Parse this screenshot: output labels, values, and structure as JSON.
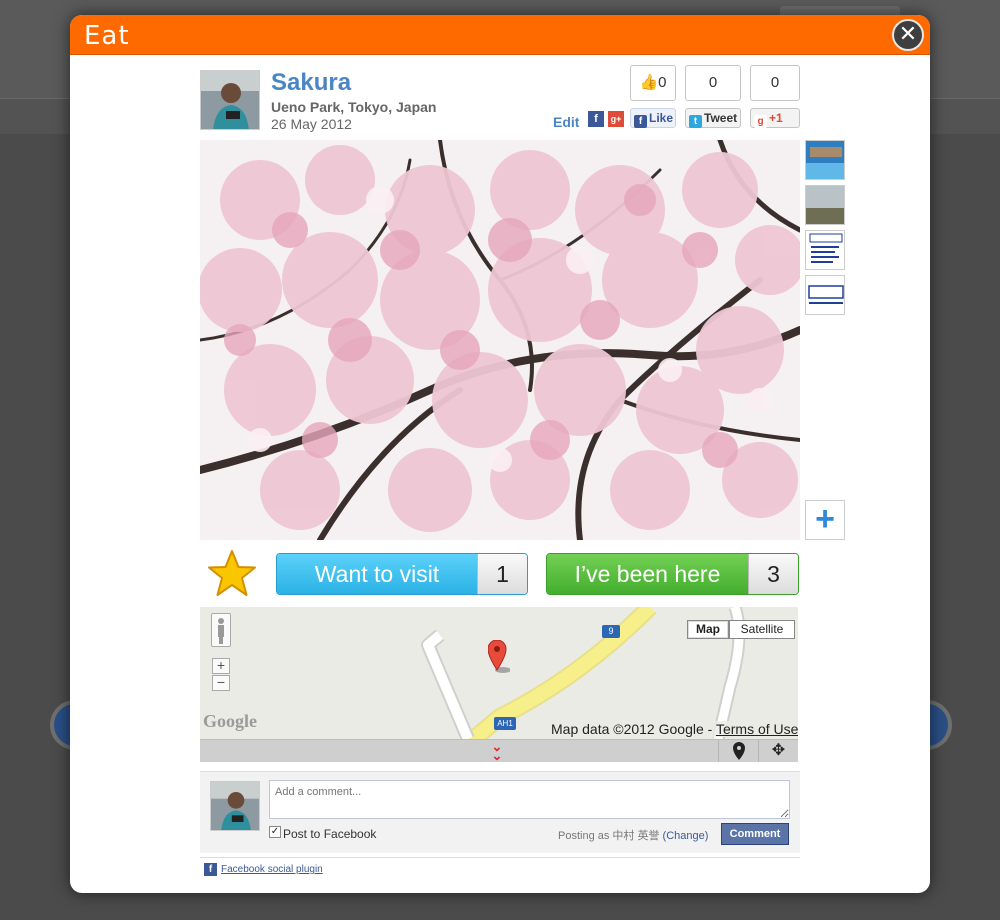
{
  "modal": {
    "title": "Eat",
    "close_symbol": "✕"
  },
  "place": {
    "name": "Sakura",
    "location": "Ueno Park, Tokyo, Japan",
    "date": "26 May 2012",
    "edit_label": "Edit"
  },
  "social": {
    "like_count": "0",
    "tweet_count": "0",
    "plus_count": "0",
    "like_label": "Like",
    "tweet_label": "Tweet",
    "plus_label": "+1"
  },
  "thumbnails": [
    "pool-photo",
    "field-photo",
    "ema-document",
    "ema-logo"
  ],
  "add_photo_symbol": "+",
  "actions": {
    "want_label": "Want to visit",
    "want_count": "1",
    "been_label": "I’ve been here",
    "been_count": "3"
  },
  "map": {
    "map_label": "Map",
    "satellite_label": "Satellite",
    "zoom_in": "+",
    "zoom_out": "−",
    "google_logo": "Google",
    "data_credit": "Map data ©2012 Google - ",
    "terms_label": "Terms of Use",
    "road_label_9": "9",
    "road_label_ah1": "AH1"
  },
  "comments": {
    "placeholder": "Add a comment...",
    "post_to_facebook": "Post to Facebook",
    "posting_as": "Posting as 中村 英誉",
    "change_label": "(Change)",
    "comment_button": "Comment",
    "plugin_label": "Facebook social plugin"
  },
  "colors": {
    "header_orange": "#ff6a00",
    "title_blue": "#4a86c5",
    "want_blue": "#2bb2e6",
    "been_green": "#44ae2e",
    "facebook_blue": "#3b5998"
  }
}
